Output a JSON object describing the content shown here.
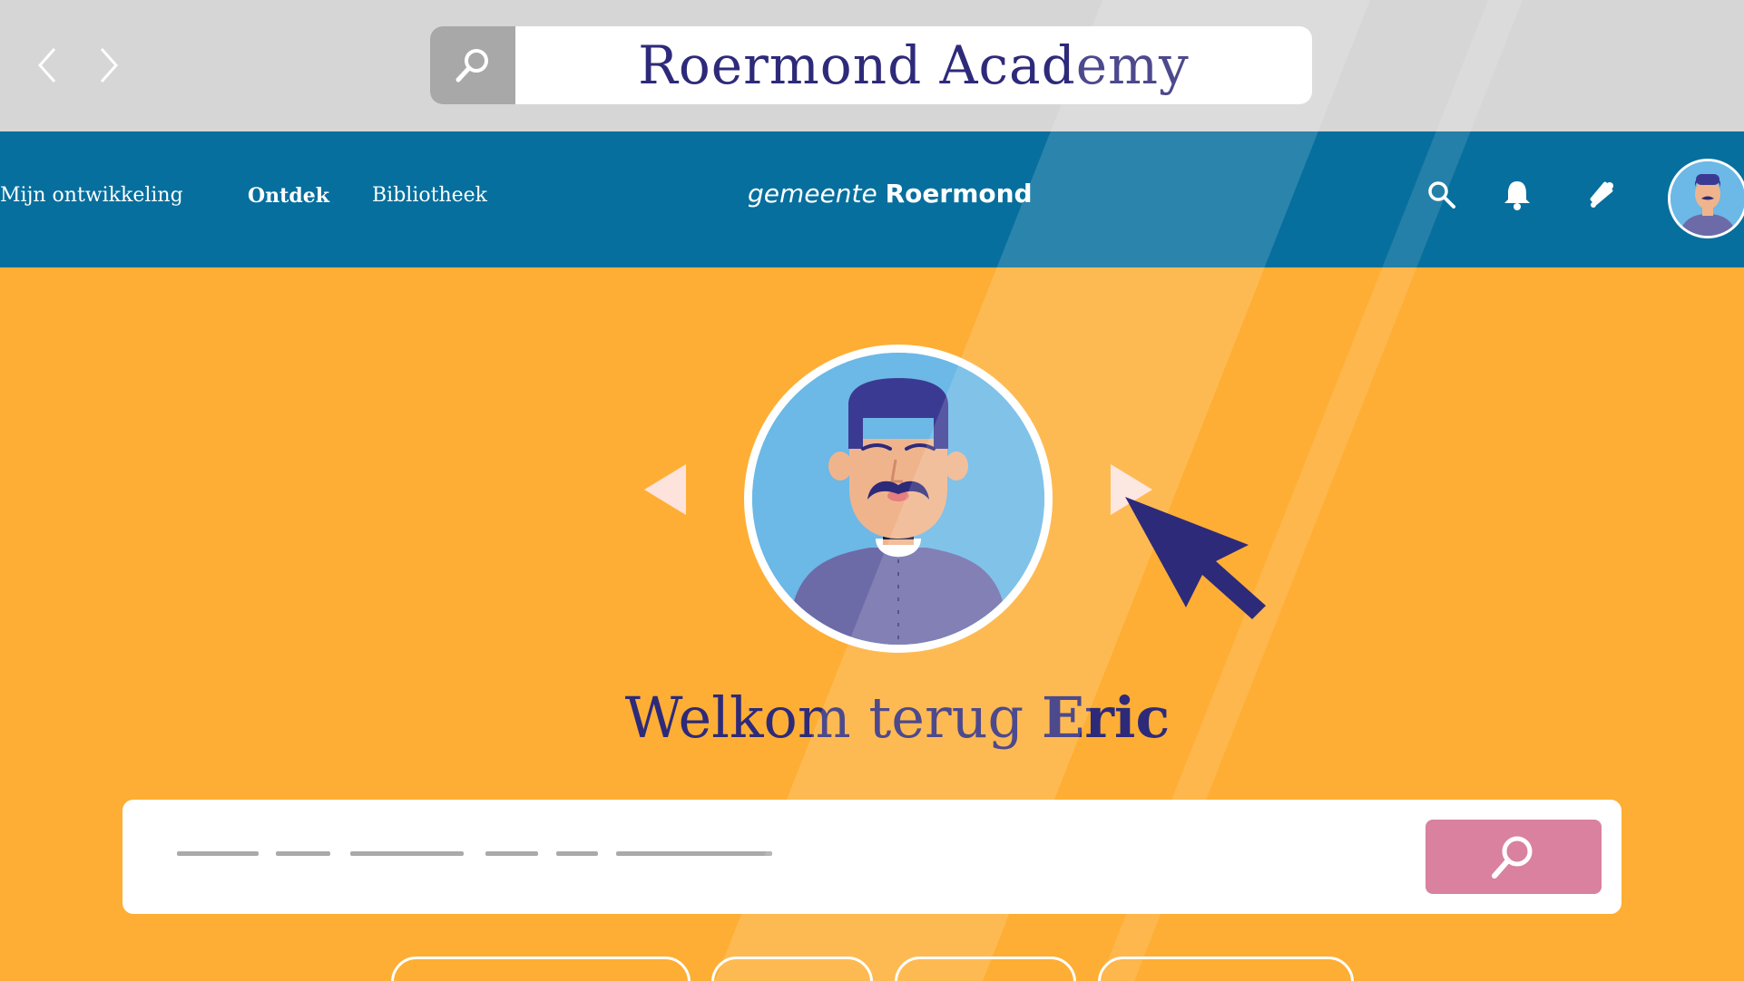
{
  "browser": {
    "address_text": "Roermond Academy",
    "back_icon": "chevron-left-icon",
    "forward_icon": "chevron-right-icon",
    "search_icon": "search-icon"
  },
  "header": {
    "menu": [
      {
        "label": "Mijn ontwikkeling",
        "active": false
      },
      {
        "label": "Ontdek",
        "active": true
      },
      {
        "label": "Bibliotheek",
        "active": false
      }
    ],
    "brand_prefix": "gemeente",
    "brand_name": "Roermond",
    "icons": [
      "search-icon",
      "bell-icon",
      "badge-tools-icon",
      "avatar"
    ]
  },
  "hero": {
    "welcome_prefix": "Welkom terug",
    "user_name": "Eric",
    "search_button_icon": "search-icon"
  },
  "colors": {
    "browser_bar": "#d6d6d6",
    "header": "#066f9d",
    "hero": "#feae34",
    "text_dark": "#2e2a7a",
    "search_button": "#d9819f",
    "avatar_bg": "#6cb8e6"
  }
}
